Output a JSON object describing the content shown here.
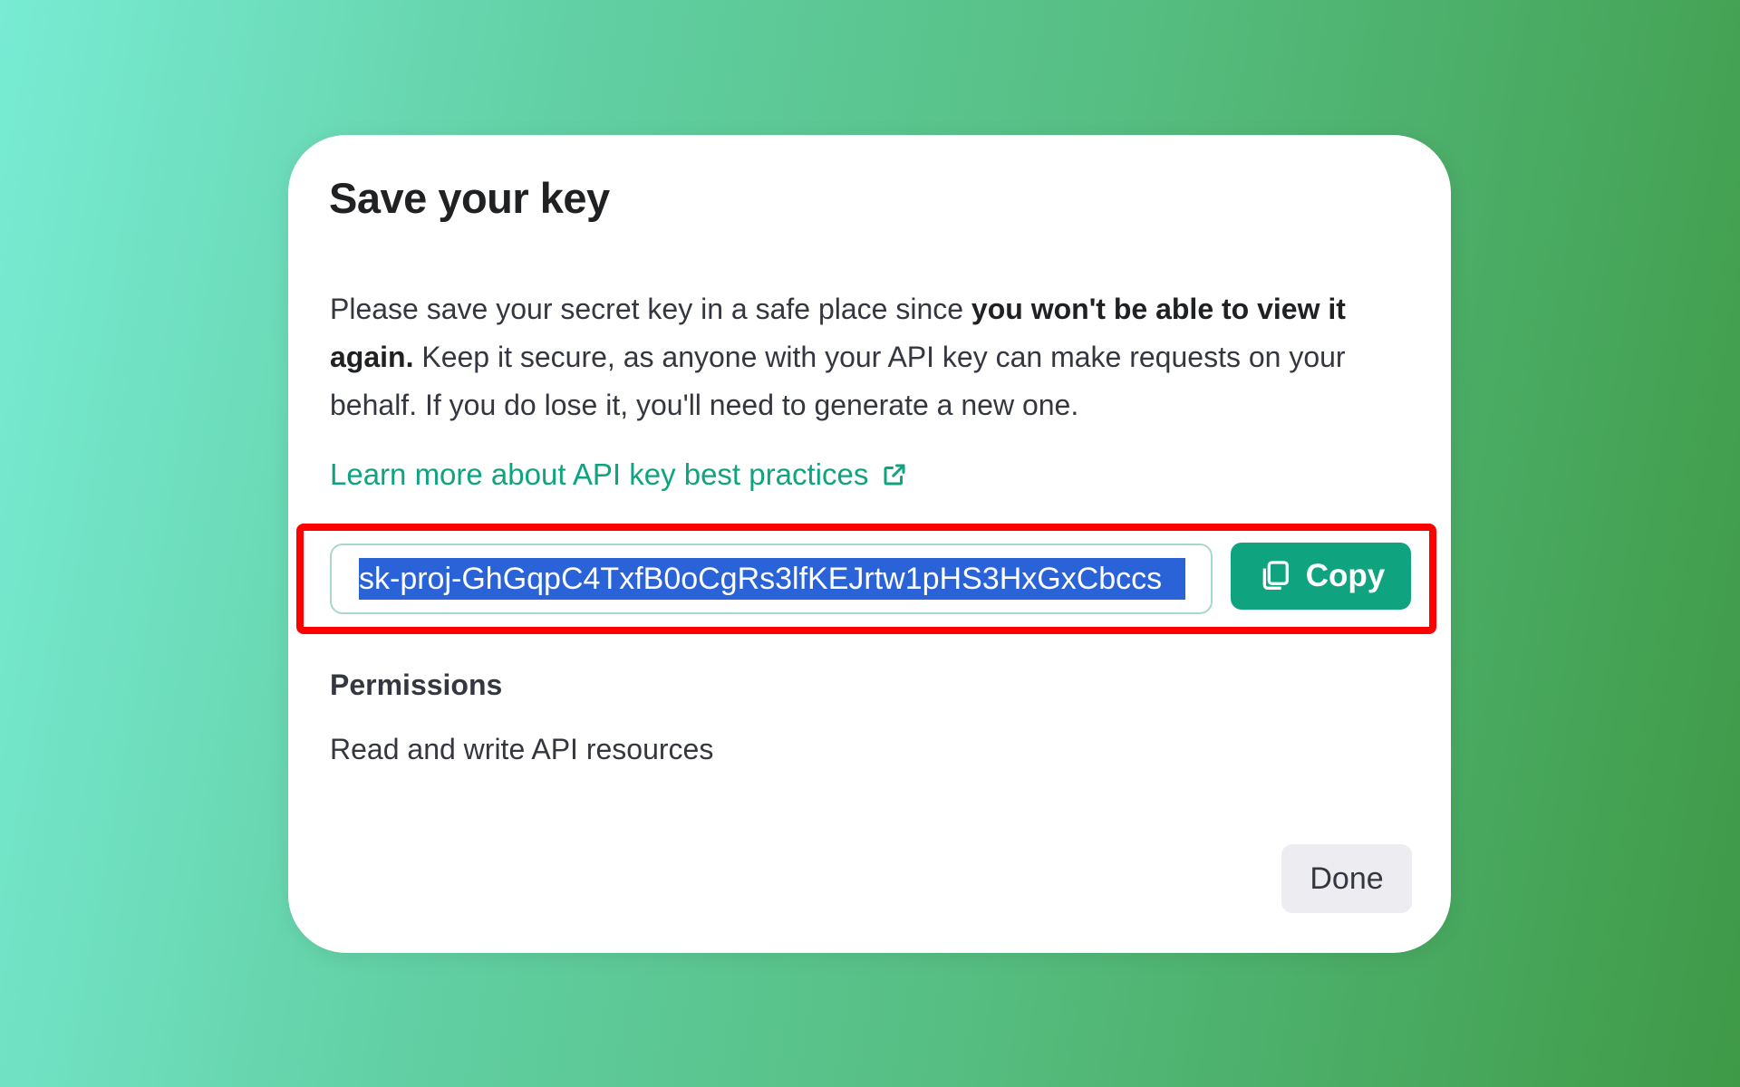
{
  "dialog": {
    "title": "Save your key",
    "description_part1": "Please save your secret key in a safe place since ",
    "description_bold1": "you won't be able to view it again.",
    "description_part2": " Keep it secure, as anyone with your API key can make requests on your behalf. If you do lose it, you'll need to generate a new one.",
    "learn_more_link": "Learn more about API key best practices",
    "api_key_value": "sk-proj-GhGqpC4TxfB0oCgRs3lfKEJrtw1pHS3HxGxCbccs",
    "copy_button": "Copy",
    "permissions_heading": "Permissions",
    "permissions_value": "Read and write API resources",
    "done_button": "Done"
  },
  "colors": {
    "accent": "#10a37f",
    "highlight_outline": "#ff0000",
    "selection": "#2a62d8"
  },
  "icons": {
    "learn_more": "external-link-icon",
    "copy": "copy-icon"
  }
}
